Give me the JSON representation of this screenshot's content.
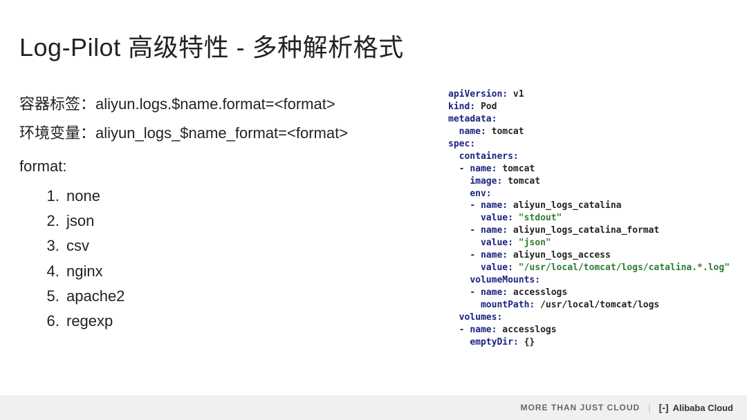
{
  "title": "Log-Pilot 高级特性 - 多种解析格式",
  "left": {
    "line1": "容器标签：aliyun.logs.$name.format=<format>",
    "line2": "环境变量：aliyun_logs_$name_format=<format>",
    "format_label": "format:",
    "formats": [
      "none",
      "json",
      "csv",
      "nginx",
      "apache2",
      "regexp"
    ]
  },
  "yaml": {
    "apiVersion_key": "apiVersion:",
    "apiVersion_val": " v1",
    "kind_key": "kind:",
    "kind_val": " Pod",
    "metadata_key": "metadata:",
    "metadata_name_key": "name:",
    "metadata_name_val": " tomcat",
    "spec_key": "spec:",
    "containers_key": "containers:",
    "dash": "- ",
    "c_name_key": "name:",
    "c_name_val": " tomcat",
    "c_image_key": "image:",
    "c_image_val": " tomcat",
    "env_key": "env:",
    "env1_name_key": "name:",
    "env1_name_val": " aliyun_logs_catalina",
    "env1_value_key": "value:",
    "env1_value_val": " \"stdout\"",
    "env2_name_key": "name:",
    "env2_name_val": " aliyun_logs_catalina_format",
    "env2_value_key": "value:",
    "env2_value_val": " \"json\"",
    "env3_name_key": "name:",
    "env3_name_val": " aliyun_logs_access",
    "env3_value_key": "value:",
    "env3_value_val": " \"/usr/local/tomcat/logs/catalina.*.log\"",
    "volumeMounts_key": "volumeMounts:",
    "vm_name_key": "name:",
    "vm_name_val": " accesslogs",
    "vm_mountPath_key": "mountPath:",
    "vm_mountPath_val": " /usr/local/tomcat/logs",
    "volumes_key": "volumes:",
    "vol_name_key": "name:",
    "vol_name_val": " accesslogs",
    "emptyDir_key": "emptyDir:",
    "emptyDir_val": " {}"
  },
  "footer": {
    "tagline": "MORE THAN JUST CLOUD",
    "sep": "|",
    "brand": "Alibaba Cloud",
    "logo": "[-]"
  }
}
